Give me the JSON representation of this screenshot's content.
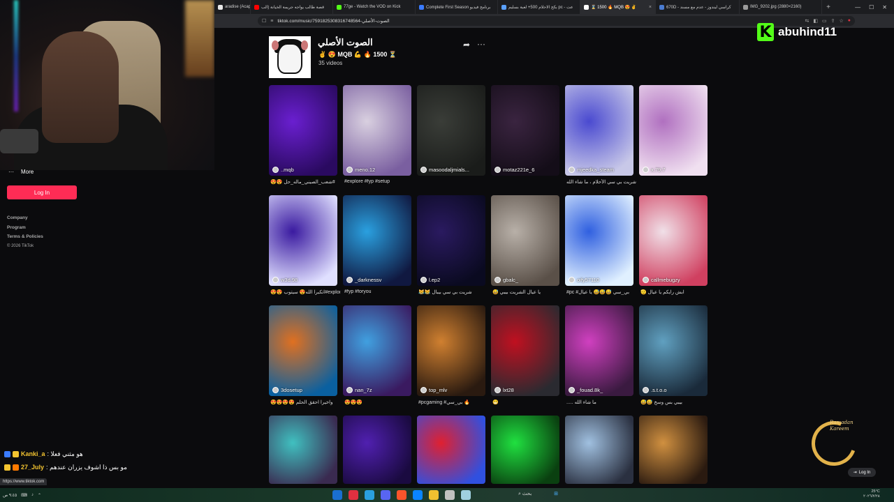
{
  "browser": {
    "tabs": [
      {
        "label": "aradise (Acapell",
        "color": "#e8e8e8",
        "active": false
      },
      {
        "label": "قصة طالب يواجه جريمة الخيانة (الب",
        "color": "#ff0000",
        "active": false
      },
      {
        "label": "77ge - Watch the VOD on Kick",
        "color": "#53fc18",
        "active": false
      },
      {
        "label": "Complete First Season برنامج فيديو",
        "color": "#3a7bff",
        "active": false
      },
      {
        "label": "بكج الاحلام 500+ لعبة بسليم pc - عت",
        "color": "#5aa0ff",
        "active": false
      },
      {
        "label": "⌛ 1500 🔥 MQB 😍 ✌",
        "color": "#ffffff",
        "active": true
      },
      {
        "label": "670D - كراسي ليندوز - عدم مع مسند",
        "color": "#4a7bd0",
        "active": false
      },
      {
        "label": "IMG_9202.jpg (2880×2160)",
        "color": "#9a9a9a",
        "active": false
      }
    ],
    "new_tab": "+",
    "window_controls": [
      "—",
      "☐",
      "✕"
    ],
    "url": "tiktok.com/music/الصوت-الأصلي-7591825308316748564",
    "status_url": "https://www.tiktok.com"
  },
  "streamer": {
    "logo_letter": "K",
    "handle": "abuhind11"
  },
  "sidebar": {
    "more_label": "More",
    "login_label": "Log In",
    "footer": [
      "Company",
      "Program",
      "Terms & Policies"
    ],
    "copyright": "© 2026 TikTok"
  },
  "sound": {
    "title": "الصوت الأصلي",
    "author": "✌️ 😍 MQB 💪 🔥 1500 ⏳",
    "video_count": "35 videos"
  },
  "videos": [
    {
      "user": "..mqb",
      "caption": "😍😍 شعب_الصيني_ماله_حل#",
      "colors": [
        "#6a1fd0",
        "#2a0a60"
      ]
    },
    {
      "user": "meno.12",
      "caption": "#explore #fyp #setup",
      "colors": [
        "#d9d0e0",
        "#7a5fa0"
      ]
    },
    {
      "user": "masoodaljmials...",
      "caption": "",
      "colors": [
        "#3a3d38",
        "#1a1c1a"
      ]
    },
    {
      "user": "motaz221e_6",
      "caption": "",
      "colors": [
        "#3a2440",
        "#140d18"
      ]
    },
    {
      "user": "mjeedka_steam",
      "caption": "شريت بي سي الأحلام ، ما شاء الله",
      "colors": [
        "#4a4ad0",
        "#c8c8e8"
      ]
    },
    {
      "user": "x.79.7",
      "caption": "",
      "colors": [
        "#b070c0",
        "#f0e0f0"
      ]
    },
    {
      "user": "w3d.98",
      "caption": "😍😍 اتكبرا الله😍 سيتوب#explore",
      "colors": [
        "#3a1aa0",
        "#e0e0ff"
      ]
    },
    {
      "user": "_darknessv",
      "caption": "#fyp #foryou",
      "colors": [
        "#2aa0e0",
        "#101840"
      ]
    },
    {
      "user": "l.ep2",
      "caption": "😹😹 شريت بي سي بيبال",
      "colors": [
        "#2a1a60",
        "#0a0a20"
      ]
    },
    {
      "user": "gbalc_",
      "caption": "😅 يا عيال الشريت بيبي",
      "colors": [
        "#b8b0a8",
        "#5a5048"
      ]
    },
    {
      "user": "oify57110",
      "caption": "#pc #بي_سي 😅😅😅 يا عيال",
      "colors": [
        "#3060e0",
        "#e0f0ff"
      ]
    },
    {
      "user": "callmebugzy",
      "caption": "🫡 ابش رايكم يا عيال",
      "colors": [
        "#f0e0e8",
        "#d04060"
      ]
    },
    {
      "user": "3dosetup",
      "caption": "😍😍😍😍 واخيرا احقق الحلم",
      "colors": [
        "#e07020",
        "#0a60a0"
      ]
    },
    {
      "user": "nan_7z",
      "caption": "😍😍😍",
      "colors": [
        "#40a0e0",
        "#3a1a60"
      ]
    },
    {
      "user": "top_mlv",
      "caption": "#pcgaming #بي_سي 🔥",
      "colors": [
        "#d08030",
        "#2a1a10"
      ]
    },
    {
      "user": "lxt28",
      "caption": "😁",
      "colors": [
        "#c01020",
        "#2a2a30"
      ]
    },
    {
      "user": "_fouad.8k_",
      "caption": "..... ما شاء الله",
      "colors": [
        "#d040c0",
        "#3a1a40"
      ]
    },
    {
      "user": ".s.t.o.o",
      "caption": "😅😅 بيبي بس وسخ",
      "colors": [
        "#60a0c0",
        "#1a2a3a"
      ]
    },
    {
      "user": "",
      "caption": "",
      "colors": [
        "#40c0c0",
        "#3a2a50"
      ]
    },
    {
      "user": "",
      "caption": "",
      "colors": [
        "#5020b0",
        "#1a0a40"
      ]
    },
    {
      "user": "",
      "caption": "",
      "colors": [
        "#e02030",
        "#3050e0"
      ]
    },
    {
      "user": "",
      "caption": "",
      "colors": [
        "#20e040",
        "#0a4010"
      ]
    },
    {
      "user": "",
      "caption": "",
      "colors": [
        "#a0c0e0",
        "#2a3040"
      ]
    },
    {
      "user": "",
      "caption": "",
      "colors": [
        "#d09040",
        "#2a1a10"
      ]
    }
  ],
  "chat": [
    {
      "name": "Kanki_a",
      "message": ": هو مثني فعلا",
      "badge_colors": [
        "#3a7bff",
        "#f4c430"
      ]
    },
    {
      "name": "27_July",
      "message": ": مو بس ذا اشوف يزران عندهم",
      "badge_colors": [
        "#f4c430",
        "#ff7a00"
      ]
    }
  ],
  "ramadan": {
    "line1": "Ramadan",
    "line2": "Kareem"
  },
  "float_login": "Log In",
  "taskbar": {
    "search_label": "بحث",
    "temp": "25°C",
    "time": "٩:٤٥ ص",
    "date": "٢٠٢٦/٢/٢٨"
  }
}
